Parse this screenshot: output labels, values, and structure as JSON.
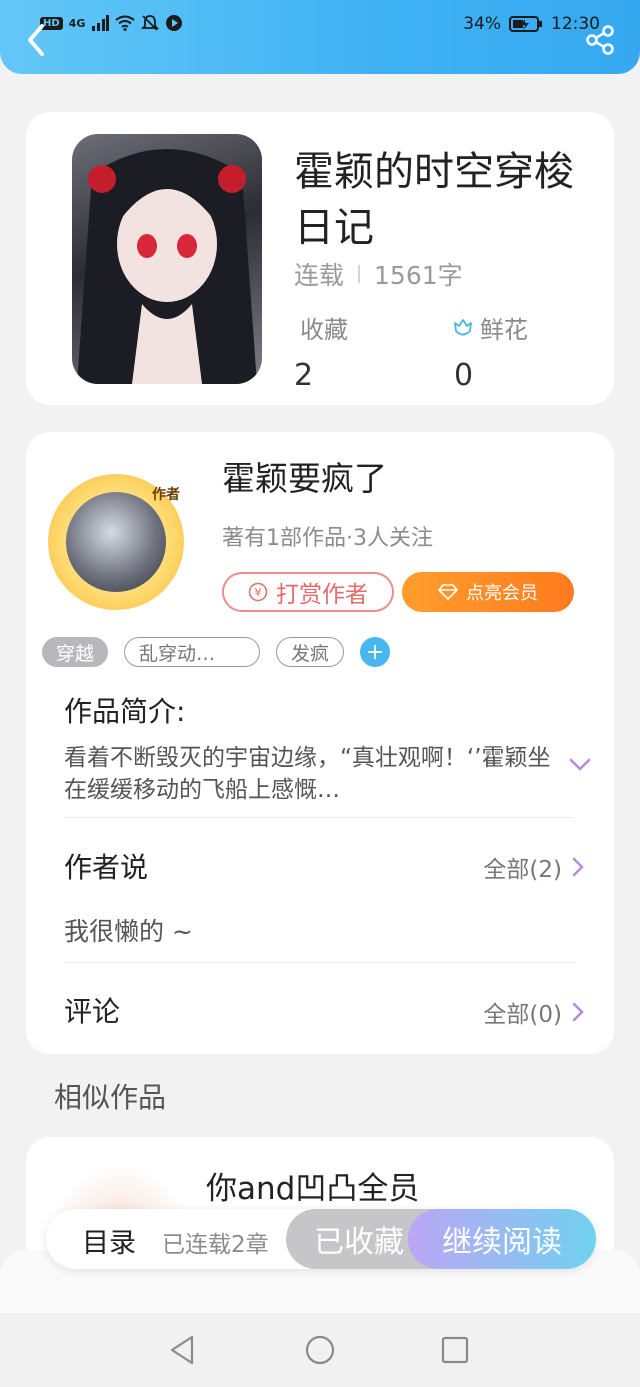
{
  "status_bar": {
    "hd_label": "HD",
    "network_label": "4G",
    "battery_percent": "34%",
    "time": "12:30"
  },
  "book": {
    "title": "霍颖的时空穿梭日记",
    "status": "连载",
    "word_count": "1561字",
    "favorites_label": "收藏",
    "favorites_value": "2",
    "flowers_label": "鲜花",
    "flowers_value": "0"
  },
  "author": {
    "name": "霍颖要疯了",
    "info": "著有1部作品·3人关注",
    "avatar_badge": "作者",
    "tip_button": "打赏作者",
    "vip_button": "点亮会员"
  },
  "tags": [
    "穿越",
    "乱穿动…",
    "发疯"
  ],
  "intro": {
    "heading": "作品简介:",
    "text": "看着不断毁灭的宇宙边缘，“真壮观啊！‘’霍颖坐在缓缓移动的飞船上感慨…"
  },
  "author_says": {
    "heading": "作者说",
    "all_link": "全部(2)",
    "content": "我很懒的 ~"
  },
  "comments": {
    "heading": "评论",
    "all_link": "全部(0)"
  },
  "similar": {
    "heading": "相似作品",
    "items": [
      {
        "title": "你and凹凸全员"
      }
    ]
  },
  "bottom_bar": {
    "catalog_label": "目录",
    "chapters_label": "已连载2章",
    "collected_label": "已收藏",
    "read_label": "继续阅读"
  },
  "colors": {
    "header_blue": "#3fb2f4",
    "accent_orange": "#ff7a1e",
    "tip_red": "#e66b6b",
    "read_gradient_start": "#bba6f5",
    "read_gradient_end": "#6fd2ef"
  }
}
